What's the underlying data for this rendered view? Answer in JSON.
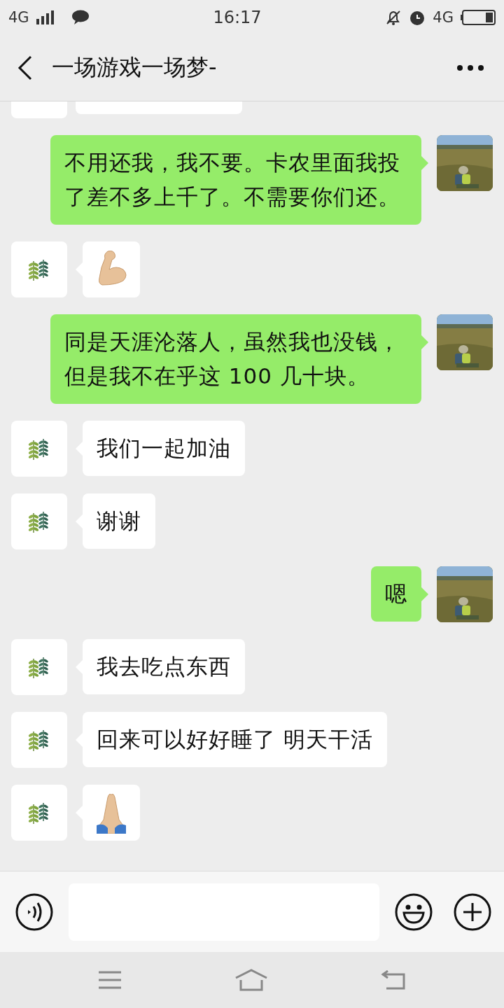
{
  "status_bar": {
    "network": "4G",
    "time": "16:17",
    "network_right": "4G"
  },
  "header": {
    "title": "一场游戏一场梦-"
  },
  "messages": [
    {
      "from_me": false,
      "kind": "partial"
    },
    {
      "from_me": true,
      "kind": "text",
      "text": "不用还我，我不要。卡农里面我投了差不多上千了。不需要你们还。"
    },
    {
      "from_me": false,
      "kind": "biceps"
    },
    {
      "from_me": true,
      "kind": "text",
      "text": "同是天涯沦落人，虽然我也没钱，但是我不在乎这 100 几十块。"
    },
    {
      "from_me": false,
      "kind": "text",
      "text": "我们一起加油"
    },
    {
      "from_me": false,
      "kind": "text",
      "text": "谢谢"
    },
    {
      "from_me": true,
      "kind": "text",
      "text": "嗯"
    },
    {
      "from_me": false,
      "kind": "text",
      "text": "我去吃点东西"
    },
    {
      "from_me": false,
      "kind": "text",
      "text": "回来可以好好睡了 明天干活"
    },
    {
      "from_me": false,
      "kind": "praying"
    }
  ]
}
